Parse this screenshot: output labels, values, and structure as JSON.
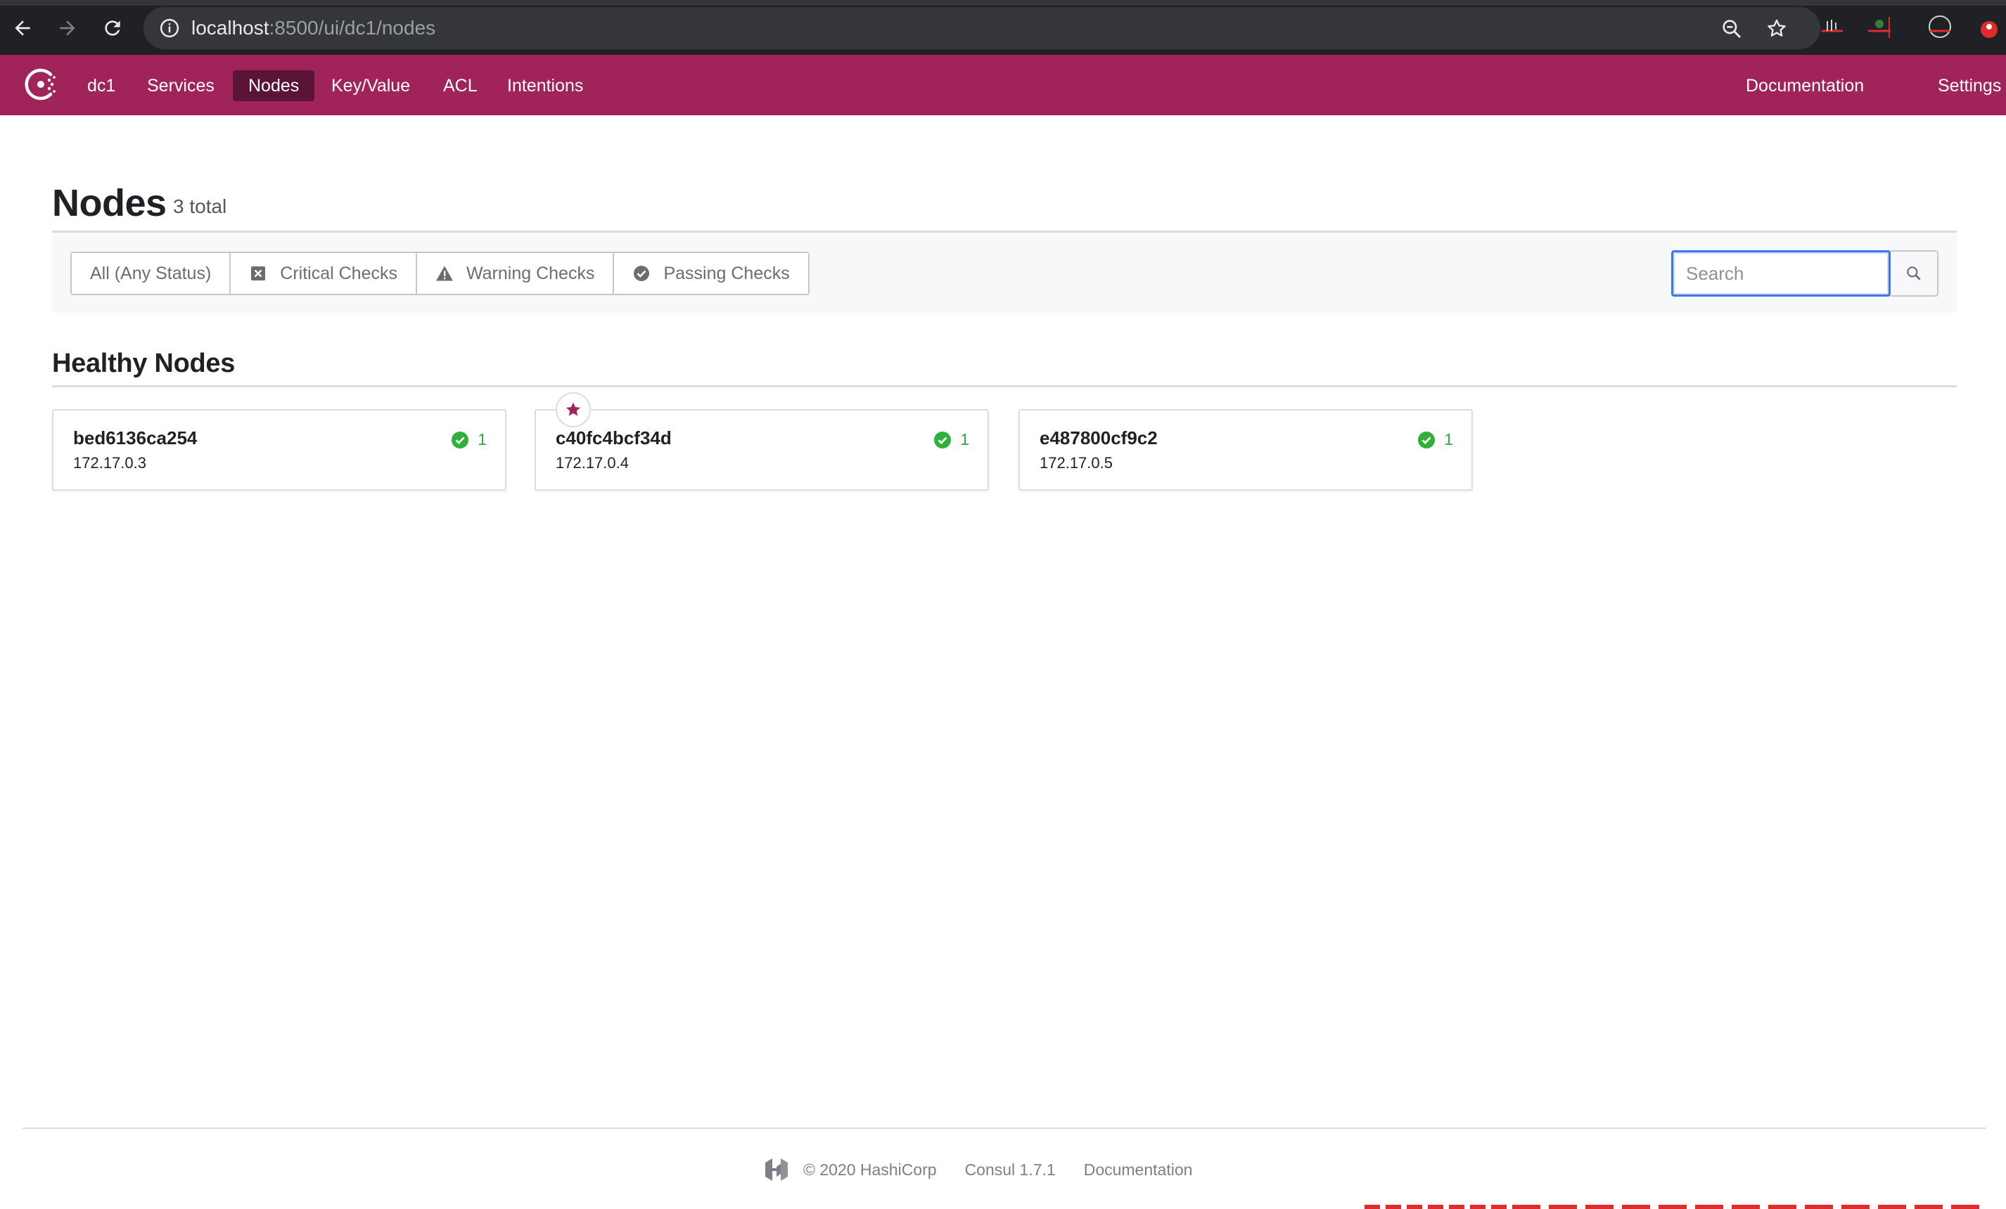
{
  "browser": {
    "url_host": "localhost",
    "url_path": ":8500/ui/dc1/nodes"
  },
  "nav": {
    "datacenter": "dc1",
    "items": [
      {
        "label": "Services",
        "active": false
      },
      {
        "label": "Nodes",
        "active": true
      },
      {
        "label": "Key/Value",
        "active": false
      },
      {
        "label": "ACL",
        "active": false
      },
      {
        "label": "Intentions",
        "active": false
      }
    ],
    "right_items": [
      "Documentation",
      "Settings"
    ]
  },
  "page": {
    "title": "Nodes",
    "count": "3 total"
  },
  "filters": [
    {
      "label": "All (Any Status)",
      "icon": ""
    },
    {
      "label": "Critical Checks",
      "icon": "critical-x-icon"
    },
    {
      "label": "Warning Checks",
      "icon": "warning-triangle-icon"
    },
    {
      "label": "Passing Checks",
      "icon": "passing-check-icon"
    }
  ],
  "search": {
    "placeholder": "Search",
    "value": ""
  },
  "section": {
    "title": "Healthy Nodes"
  },
  "nodes": [
    {
      "name": "bed6136ca254",
      "ip": "172.17.0.3",
      "passing": "1",
      "leader": false
    },
    {
      "name": "c40fc4bcf34d",
      "ip": "172.17.0.4",
      "passing": "1",
      "leader": true
    },
    {
      "name": "e487800cf9c2",
      "ip": "172.17.0.5",
      "passing": "1",
      "leader": false
    }
  ],
  "footer": {
    "copyright": "© 2020 HashiCorp",
    "version": "Consul 1.7.1",
    "docs": "Documentation"
  },
  "colors": {
    "brand": "#a0245a",
    "brand_active": "#5c1436",
    "passing": "#2eb039",
    "focus": "#3d78e6"
  }
}
